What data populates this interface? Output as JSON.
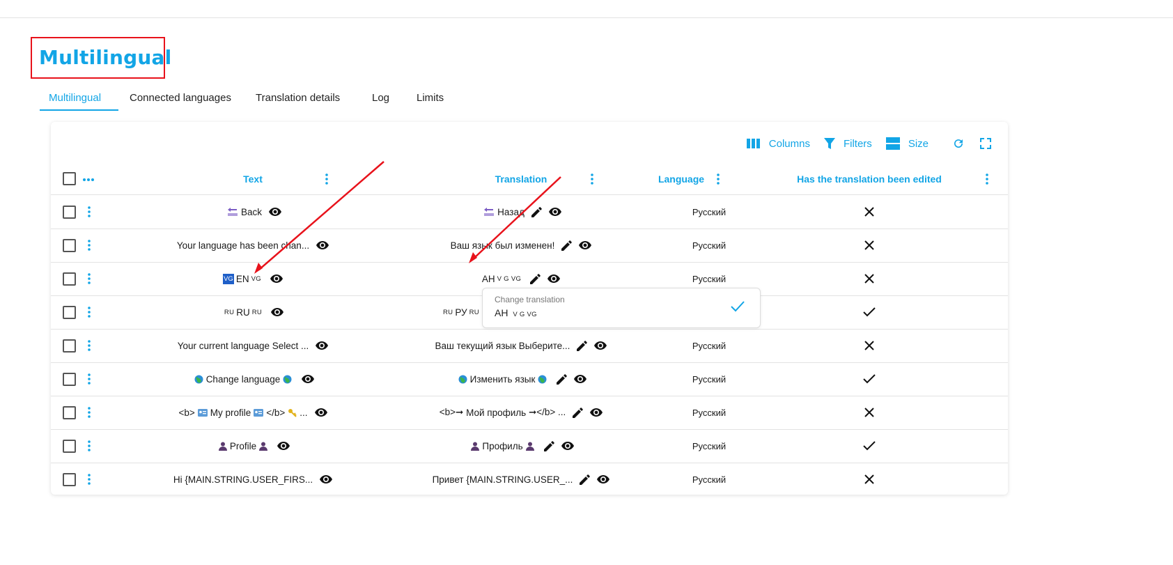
{
  "page": {
    "title": "Multilingual"
  },
  "tabs": [
    {
      "label": "Multilingual",
      "active": true
    },
    {
      "label": "Connected languages"
    },
    {
      "label": "Translation details"
    },
    {
      "label": "Log"
    },
    {
      "label": "Limits"
    }
  ],
  "toolbar": {
    "columns": "Columns",
    "filters": "Filters",
    "size": "Size"
  },
  "columns": {
    "text": "Text",
    "translation": "Translation",
    "language": "Language",
    "edited": "Has the translation been edited"
  },
  "rows": [
    {
      "text": "Back",
      "translation": "Назад",
      "language": "Русский",
      "edited": false
    },
    {
      "text": "Your language has been chan...",
      "translation": "Ваш язык был изменен!",
      "language": "Русский",
      "edited": false
    },
    {
      "text_prefix": "VG",
      "text": "EN",
      "text_suffix": "VG",
      "translation": "АН",
      "translation_suffix": "V G VG",
      "language": "Русский",
      "edited": false
    },
    {
      "text_prefix": "RU",
      "text": "RU",
      "text_suffix": "RU",
      "translation_prefix": "RU",
      "translation": "РУ",
      "translation_suffix": "RU",
      "edited": true
    },
    {
      "text": "Your current language Select ...",
      "translation": "Ваш текущий язык Выберите...",
      "language": "Русский",
      "edited": false
    },
    {
      "text": "Change language",
      "translation": "Изменить язык",
      "language": "Русский",
      "edited": true
    },
    {
      "text_prefix": "<b>",
      "text": "My profile",
      "text_suffix": "</b>",
      "text_tail": "...",
      "translation_prefix": "<b>➞",
      "translation": "Мой профиль",
      "translation_suffix": "➞</b> ...",
      "language": "Русский",
      "edited": false
    },
    {
      "text": "Profile",
      "translation": "Профиль",
      "language": "Русский",
      "edited": true
    },
    {
      "text": "Hi {MAIN.STRING.USER_FIRS...",
      "translation": "Привет {MAIN.STRING.USER_...",
      "language": "Русский",
      "edited": false
    }
  ],
  "popup": {
    "label": "Change translation",
    "value": "АН",
    "value_suffix": "V G VG"
  },
  "colors": {
    "accent": "#12a5e6",
    "annotation": "#e8121b"
  }
}
